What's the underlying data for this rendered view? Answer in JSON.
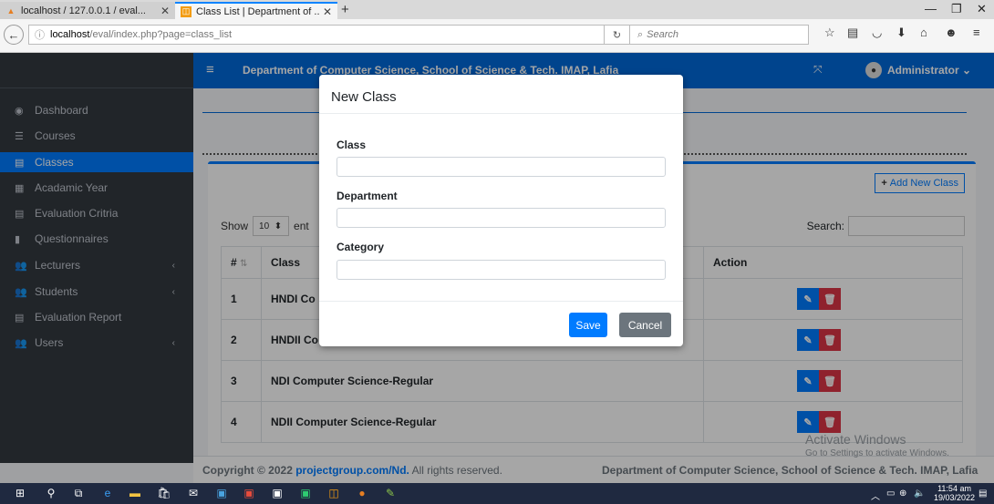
{
  "browser": {
    "tabs": [
      {
        "title": "localhost / 127.0.0.1 / eval...",
        "favicon": "phpmyadmin-icon"
      },
      {
        "title": "Class List | Department of ...",
        "favicon": "app-favicon"
      }
    ],
    "url_host": "localhost",
    "url_path": "/eval/index.php?page=class_list",
    "search_placeholder": "Search"
  },
  "sidebar": {
    "items": [
      {
        "label": "Dashboard",
        "icon": "dashboard-icon"
      },
      {
        "label": "Courses",
        "icon": "list-icon"
      },
      {
        "label": "Classes",
        "icon": "list-icon",
        "active": true
      },
      {
        "label": "Acadamic Year",
        "icon": "calendar-icon"
      },
      {
        "label": "Evaluation Critria",
        "icon": "list-icon"
      },
      {
        "label": "Questionnaires",
        "icon": "book-icon"
      },
      {
        "label": "Lecturers",
        "icon": "users-icon"
      },
      {
        "label": "Students",
        "icon": "users-icon"
      },
      {
        "label": "Evaluation Report",
        "icon": "list-icon"
      },
      {
        "label": "Users",
        "icon": "users-icon"
      }
    ]
  },
  "header": {
    "dept_title": "Department of Computer Science, School of Science & Tech. IMAP, Lafia",
    "user": "Administrator"
  },
  "card": {
    "add_button": "Add New Class",
    "show_label": "Show",
    "entries_value": "10",
    "entries_label": "ent",
    "search_label": "Search:"
  },
  "table": {
    "headers": [
      "#",
      "Class",
      "Action"
    ],
    "rows": [
      {
        "num": "1",
        "class": "HNDI Co"
      },
      {
        "num": "2",
        "class": "HNDII Co"
      },
      {
        "num": "3",
        "class": "NDI Computer Science-Regular"
      },
      {
        "num": "4",
        "class": "NDII Computer Science-Regular"
      }
    ]
  },
  "modal": {
    "title": "New Class",
    "fields": [
      {
        "label": "Class",
        "value": ""
      },
      {
        "label": "Department",
        "value": ""
      },
      {
        "label": "Category",
        "value": ""
      }
    ],
    "save": "Save",
    "cancel": "Cancel"
  },
  "footer": {
    "copyright_prefix": "Copyright © 2022",
    "link": "projectgroup.com/Nd.",
    "copyright_suffix": "All rights reserved.",
    "dept": "Department of Computer Science, School of Science & Tech. IMAP, Lafia"
  },
  "watermark": {
    "line1": "Activate Windows",
    "line2": "Go to Settings to activate Windows."
  },
  "taskbar": {
    "time": "11:54 am",
    "date": "19/03/2022"
  },
  "colors": {
    "primary": "#007bff",
    "header": "#0069d9",
    "sidebar": "#343a40",
    "danger": "#dc3545"
  }
}
